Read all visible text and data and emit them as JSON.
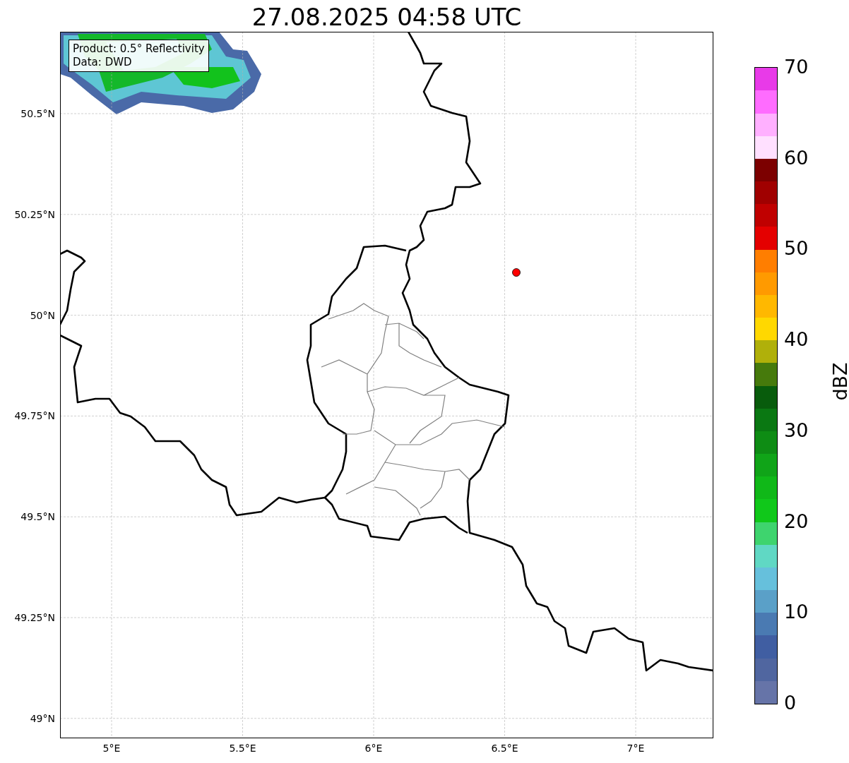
{
  "title": "27.08.2025 04:58 UTC",
  "info_box": [
    "Product: 0.5° Reflectivity",
    "Data: DWD"
  ],
  "map": {
    "lat_ticks": [
      "50.5°N",
      "50.25°N",
      "50°N",
      "49.75°N",
      "49.5°N",
      "49.25°N",
      "49°N"
    ],
    "lon_ticks": [
      "5°E",
      "5.5°E",
      "6°E",
      "6.5°E",
      "7°E"
    ]
  },
  "colorbar": {
    "label": "dBZ",
    "ticks": [
      "70",
      "60",
      "50",
      "40",
      "30",
      "20",
      "10",
      "0"
    ],
    "bins": [
      {
        "color": "#6674a8"
      },
      {
        "color": "#5066a0"
      },
      {
        "color": "#405ea2"
      },
      {
        "color": "#4a7ab2"
      },
      {
        "color": "#5aa0c8"
      },
      {
        "color": "#66c0dc"
      },
      {
        "color": "#60d8c4"
      },
      {
        "color": "#3ed46e"
      },
      {
        "color": "#10c81a"
      },
      {
        "color": "#10b818"
      },
      {
        "color": "#10a418"
      },
      {
        "color": "#0e8c14"
      },
      {
        "color": "#0a7812"
      },
      {
        "color": "#085c0c"
      },
      {
        "color": "#467a0c"
      },
      {
        "color": "#b0b00a"
      },
      {
        "color": "#ffd800"
      },
      {
        "color": "#ffb800"
      },
      {
        "color": "#ff9a00"
      },
      {
        "color": "#ff7e00"
      },
      {
        "color": "#e40000"
      },
      {
        "color": "#c00000"
      },
      {
        "color": "#a00000"
      },
      {
        "color": "#7c0000"
      },
      {
        "color": "#ffe0ff"
      },
      {
        "color": "#ffb0ff"
      },
      {
        "color": "#ff6cff"
      },
      {
        "color": "#e83ae8"
      }
    ]
  }
}
